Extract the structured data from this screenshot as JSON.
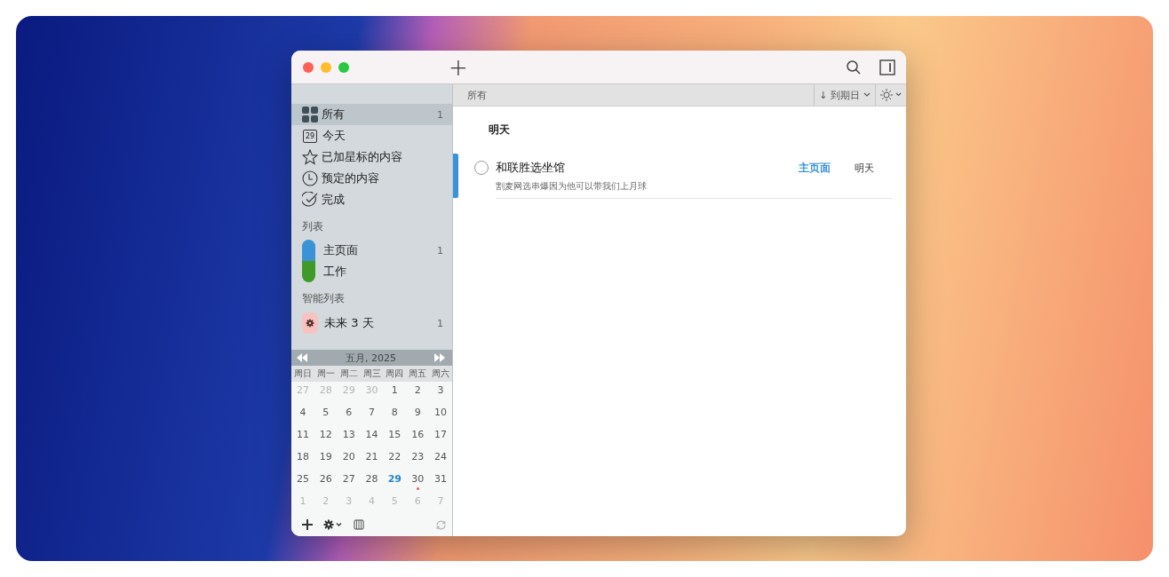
{
  "toolbar": {
    "add": "+"
  },
  "sidebar": {
    "items": [
      {
        "label": "所有",
        "count": "1",
        "selected": true
      },
      {
        "label": "今天",
        "icon_text": "29",
        "selected": false
      },
      {
        "label": "已加星标的内容",
        "selected": false
      },
      {
        "label": "预定的内容",
        "selected": false
      },
      {
        "label": "完成",
        "selected": false
      }
    ],
    "lists_heading": "列表",
    "lists": [
      {
        "label": "主页面",
        "count": "1",
        "color": "#3a93d6",
        "selected": false
      },
      {
        "label": "工作",
        "color": "#3f9a2a",
        "selected": false
      }
    ],
    "smart_heading": "智能列表",
    "smart_lists": [
      {
        "label": "未来 3 天",
        "count": "1",
        "selected": false
      }
    ]
  },
  "calendar": {
    "title": "五月, 2025",
    "weekdays": [
      "周日",
      "周一",
      "周二",
      "周三",
      "周四",
      "周五",
      "周六"
    ],
    "weeks": [
      [
        {
          "day": "27",
          "other_month": true
        },
        {
          "day": "28",
          "other_month": true
        },
        {
          "day": "29",
          "other_month": true
        },
        {
          "day": "30",
          "other_month": true
        },
        {
          "day": "1",
          "other_month": false
        },
        {
          "day": "2",
          "other_month": false
        },
        {
          "day": "3",
          "other_month": false
        }
      ],
      [
        {
          "day": "4",
          "other_month": false
        },
        {
          "day": "5",
          "other_month": false
        },
        {
          "day": "6",
          "other_month": false
        },
        {
          "day": "7",
          "other_month": false
        },
        {
          "day": "8",
          "other_month": false
        },
        {
          "day": "9",
          "other_month": false
        },
        {
          "day": "10",
          "other_month": false
        }
      ],
      [
        {
          "day": "11",
          "other_month": false
        },
        {
          "day": "12",
          "other_month": false
        },
        {
          "day": "13",
          "other_month": false
        },
        {
          "day": "14",
          "other_month": false
        },
        {
          "day": "15",
          "other_month": false
        },
        {
          "day": "16",
          "other_month": false
        },
        {
          "day": "17",
          "other_month": false
        }
      ],
      [
        {
          "day": "18",
          "other_month": false
        },
        {
          "day": "19",
          "other_month": false
        },
        {
          "day": "20",
          "other_month": false
        },
        {
          "day": "21",
          "other_month": false
        },
        {
          "day": "22",
          "other_month": false
        },
        {
          "day": "23",
          "other_month": false
        },
        {
          "day": "24",
          "other_month": false
        }
      ],
      [
        {
          "day": "25",
          "other_month": false
        },
        {
          "day": "26",
          "other_month": false
        },
        {
          "day": "27",
          "other_month": false
        },
        {
          "day": "28",
          "other_month": false
        },
        {
          "day": "29",
          "other_month": false,
          "today": true
        },
        {
          "day": "30",
          "other_month": false,
          "has_item": true
        },
        {
          "day": "31",
          "other_month": false
        }
      ],
      [
        {
          "day": "1",
          "other_month": true
        },
        {
          "day": "2",
          "other_month": true
        },
        {
          "day": "3",
          "other_month": true
        },
        {
          "day": "4",
          "other_month": true
        },
        {
          "day": "5",
          "other_month": true
        },
        {
          "day": "6",
          "other_month": true
        },
        {
          "day": "7",
          "other_month": true
        }
      ]
    ]
  },
  "main": {
    "title": "所有",
    "sort": "到期日",
    "sort_arrow": "↓",
    "groups": [
      {
        "heading": "明天",
        "tasks": [
          {
            "title": "和联胜选坐馆",
            "note": "割麦网选串爆因为他可以带我们上月球",
            "list": "主页面",
            "color": "#3a93d6",
            "due": "明天",
            "checked": false,
            "selected": true
          }
        ]
      }
    ]
  }
}
